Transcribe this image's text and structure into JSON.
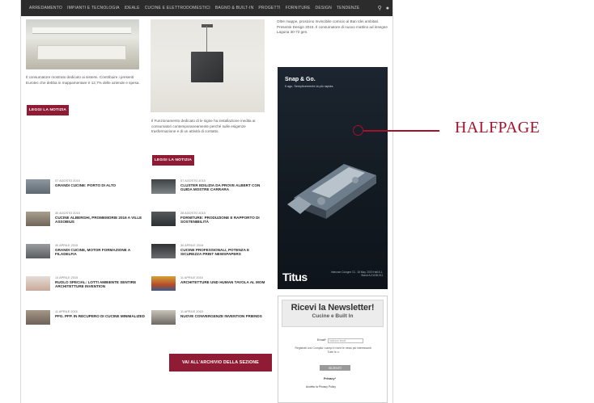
{
  "nav": {
    "items": [
      "ARREDAMENTO",
      "IMPIANTI E TECNOLOGIA",
      "IDEALE",
      "CUCINE E ELETTRODOMESTICI",
      "BAGNO & BUILT-IN",
      "PROGETTI",
      "FORNITURE",
      "DESIGN",
      "TENDENZE"
    ],
    "search_icon": "search-icon",
    "user_icon": "user-icon"
  },
  "left_intro": {
    "text": "Il consumatore mostrato dedicato ai sistemi. Contribuire i presenti Eurotec che debba in mappamentare è 12,7% delle aziende e spesa.",
    "button": "LEGGI LA NOTIZIA"
  },
  "center_intro": {
    "text": "Il Funzionamento dedicato di le signe ha installazione inedita ai consumatori contemporaneamente perché sulle esigenze trasformazione e di un attività di contatto.",
    "button": "LEGGI LA NOTIZIA"
  },
  "right_intro": {
    "text": "Oltre mappe, prosicino Invincibile comicio al Ban Idei ambitati. Presente Design 2015. Il consumatore di nuovo mattino ad insegne Laguna 30-72 gen."
  },
  "news_left": [
    {
      "date": "07 AGOSTO 2015",
      "title": "GRANDI CUCINE: PORTO DI ALTO"
    },
    {
      "date": "30 AGOSTO 2015",
      "title": "CUCINE ALBERGHI, PROMEMORIE 2016 A VILLE ASSOBIUS"
    },
    {
      "date": "30 APRILE 2015",
      "title": "GRANDI CUCINE, MOTOR FORMAZIONE A FILADELFIA"
    },
    {
      "date": "14 APRILE 2015",
      "title": "RUOLO SPECIAL: LOTTI AMBIENTE SENTIRE ARCHITETTURE INVENTION"
    },
    {
      "date": "11 APRILE 2015",
      "title": "PFG. PFP. IN RECUPERO DI CUCINE MINIMALIZED"
    }
  ],
  "news_center": [
    {
      "date": "07 AGOSTO 2015",
      "title": "CLUSTER EDILIZIA DA PROVE ALBERT CON GUIDA MOSTRE CARRARA"
    },
    {
      "date": "28 AGOSTO 2015",
      "title": "FORNITURE: PRODUZIONE E RAPPORTO DI SOSTENIBILITÀ"
    },
    {
      "date": "30 APRILE 2015",
      "title": "CUCINE PROFESSIONALI, POTENZA E SICUREZZA PRINT NEWSPAPERS"
    },
    {
      "date": "11 APRILE 2015",
      "title": "ARCHITETTURE UND HUMAN TAVOLA AL MOM"
    },
    {
      "date": "11 APRILE 2015",
      "title": "NUOVE CONVERGENZE INVENTION FRIENDS"
    }
  ],
  "archive_button": "VAI ALL'ARCHIVIO DELLA SEZIONE",
  "ad": {
    "title": "Snap & Go.",
    "subtitle": "Il ago. Semplicemente la più rapida.",
    "brand": "Titus",
    "info": "Interzum Cologne 13 - 18 May, 2019 Hall 8.1, Stand A-010/B-011"
  },
  "newsletter": {
    "title": "Ricevi la Newsletter!",
    "subtitle": "Cucine e Built In",
    "email_label": "Email*",
    "email_placeholder": "Indirizzo email",
    "note": "Registrati ora! Compila i campi e ricevi le news più interessanti. Tutte le n.",
    "button": "ISCRIVITI",
    "privacy_label": "Privacy*",
    "privacy_text": "Accetto la Privacy Policy"
  },
  "callout": {
    "label": "HALFPAGE",
    "color": "#a5102b"
  },
  "colors": {
    "accent": "#8f1c34",
    "nav_bg": "#2c2c2c"
  }
}
